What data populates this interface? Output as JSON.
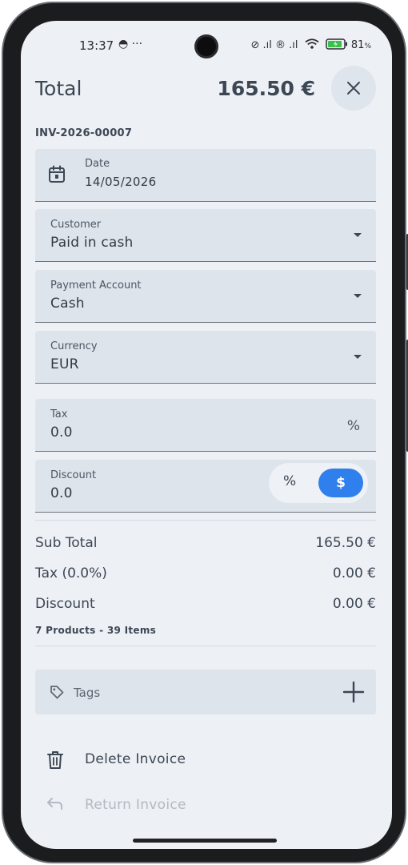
{
  "status_bar": {
    "time": "13:37",
    "left_icons": "◓ ···",
    "right_icons": "⊘ .ıl ® .ıl",
    "battery": "81"
  },
  "header": {
    "title": "Total",
    "total": "165.50 €"
  },
  "invoice_number": "INV-2026-00007",
  "fields": {
    "date": {
      "label": "Date",
      "value": "14/05/2026"
    },
    "customer": {
      "label": "Customer",
      "value": "Paid in cash"
    },
    "payment_account": {
      "label": "Payment Account",
      "value": "Cash"
    },
    "currency": {
      "label": "Currency",
      "value": "EUR"
    },
    "tax": {
      "label": "Tax",
      "value": "0.0",
      "suffix": "%"
    },
    "discount": {
      "label": "Discount",
      "value": "0.0",
      "toggle_percent": "%",
      "toggle_amount": "$",
      "selected": "$"
    }
  },
  "summary": {
    "sub_total_label": "Sub Total",
    "sub_total_value": "165.50 €",
    "tax_label": "Tax (0.0%)",
    "tax_value": "0.00 €",
    "discount_label": "Discount",
    "discount_value": "0.00 €",
    "items_count": "7 Products - 39 Items"
  },
  "tags": {
    "label": "Tags"
  },
  "actions": {
    "delete_label": "Delete Invoice",
    "return_label": "Return Invoice"
  },
  "colors": {
    "background": "#edf0f4",
    "field": "#dde4ec",
    "text": "#3c4654",
    "accent": "#2f80ed",
    "disabled": "#b3bac3"
  }
}
